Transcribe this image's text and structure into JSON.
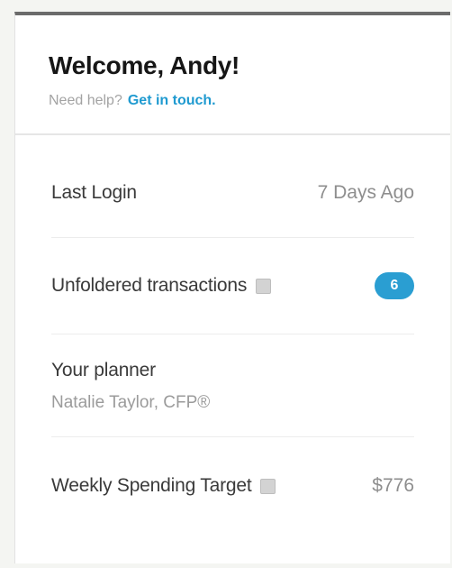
{
  "header": {
    "welcome": "Welcome, Andy!",
    "help_prefix": "Need help?",
    "help_link": "Get in touch."
  },
  "rows": {
    "last_login": {
      "label": "Last Login",
      "value": "7 Days Ago"
    },
    "unfoldered": {
      "label": "Unfoldered transactions",
      "count": "6",
      "info_icon": "info-icon"
    },
    "planner": {
      "label": "Your planner",
      "name": "Natalie Taylor, CFP®"
    },
    "spending": {
      "label": "Weekly Spending Target",
      "value": "$776",
      "info_icon": "info-icon"
    }
  },
  "colors": {
    "accent": "#2a9ed2",
    "link": "#1f9ad0",
    "top_border": "#6b6b6b"
  }
}
